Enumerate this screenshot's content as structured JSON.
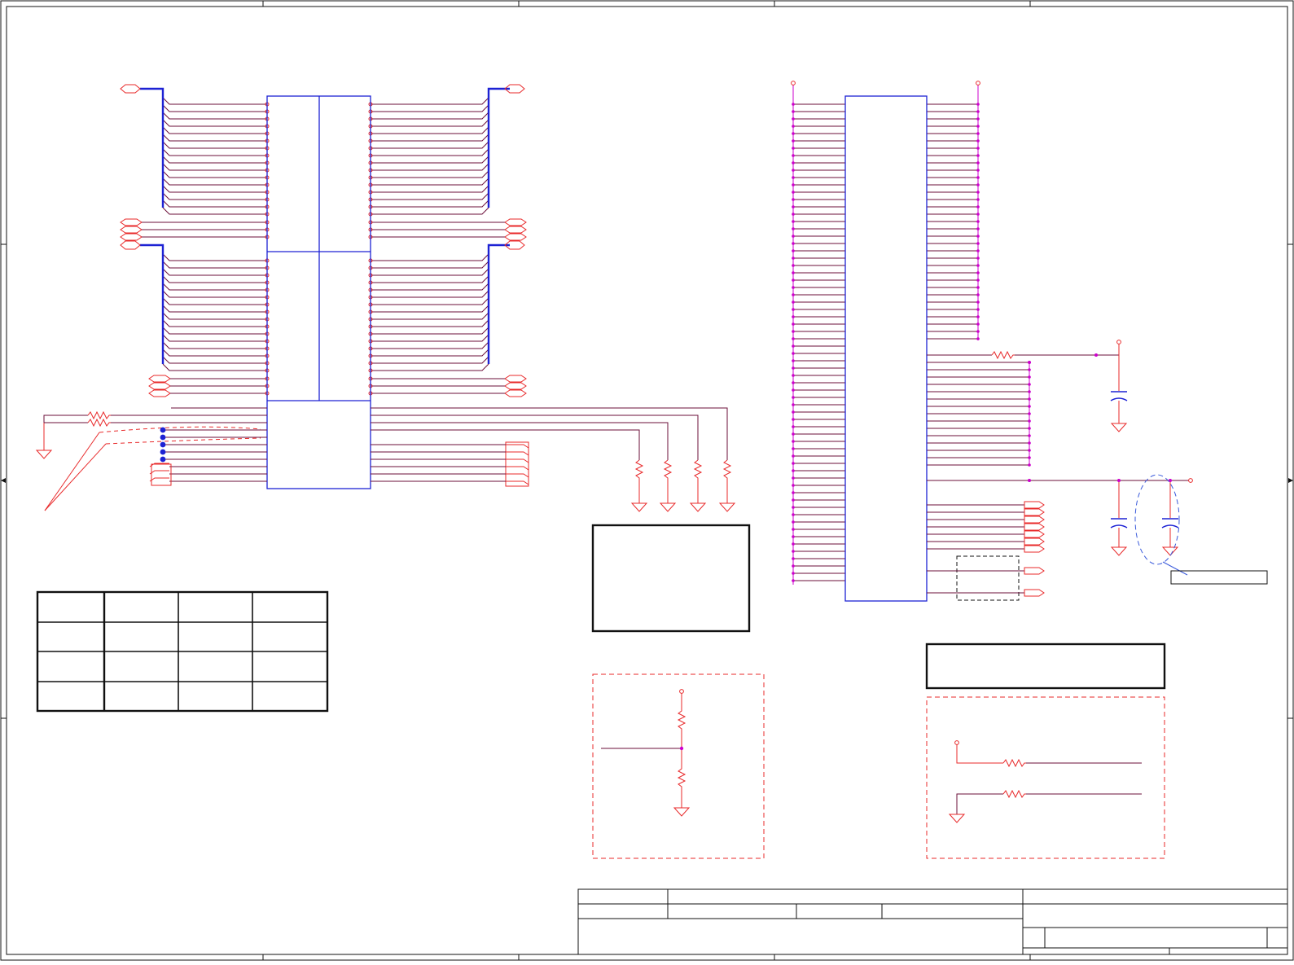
{
  "sheet": {
    "title": "",
    "colors": {
      "wire": "#e8292a",
      "net": "#6b0f3a",
      "part": "#1d22d4",
      "frame": "#111111",
      "pin": "#cc00cc",
      "note": "#3b5bdb"
    }
  },
  "pin_table": {
    "rows": [
      [
        "",
        "",
        "",
        ""
      ],
      [
        "",
        "",
        "",
        ""
      ],
      [
        "",
        "",
        "",
        ""
      ],
      [
        "",
        "",
        "",
        ""
      ]
    ]
  },
  "notes": {
    "callout_label": "",
    "center_box_text": "",
    "right_box_text": ""
  },
  "title_block": {
    "title": "",
    "size": "",
    "document_number": "",
    "rev": "",
    "date": "",
    "sheet": ""
  }
}
